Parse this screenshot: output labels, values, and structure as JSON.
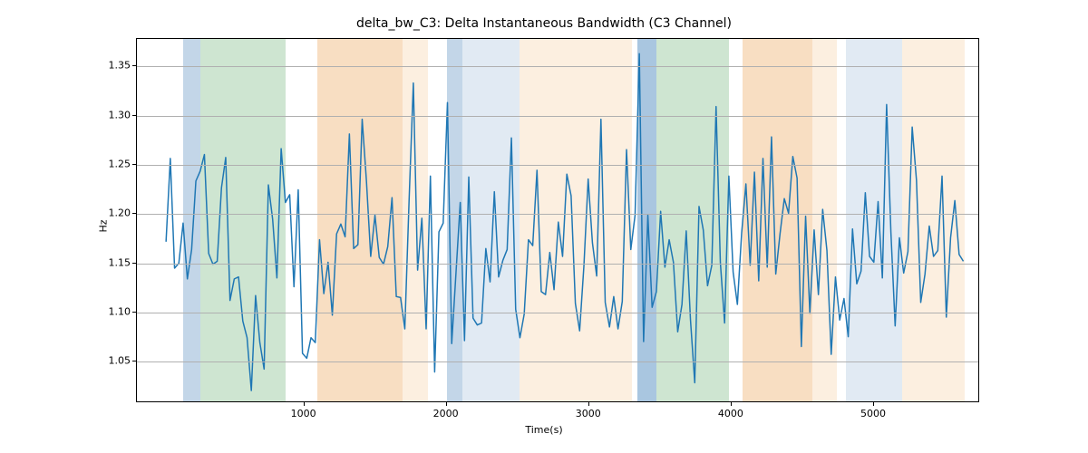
{
  "chart_data": {
    "type": "line",
    "title": "delta_bw_C3: Delta Instantaneous Bandwidth (C3 Channel)",
    "xlabel": "Time(s)",
    "ylabel": "Hz",
    "xlim": [
      -175,
      5745
    ],
    "ylim": [
      1.008,
      1.378
    ],
    "xticks": [
      1000,
      2000,
      3000,
      4000,
      5000
    ],
    "yticks": [
      1.05,
      1.1,
      1.15,
      1.2,
      1.25,
      1.3,
      1.35
    ],
    "grid_y": true,
    "bands": [
      {
        "start": 150,
        "end": 270,
        "color": "#c3d6e8"
      },
      {
        "start": 270,
        "end": 870,
        "color": "#cee5d1"
      },
      {
        "start": 1090,
        "end": 1690,
        "color": "#f8dec2"
      },
      {
        "start": 1690,
        "end": 1870,
        "color": "#fcefe0"
      },
      {
        "start": 2000,
        "end": 2110,
        "color": "#c3d6e8"
      },
      {
        "start": 2110,
        "end": 2510,
        "color": "#e1eaf3"
      },
      {
        "start": 2510,
        "end": 3300,
        "color": "#fcefe0"
      },
      {
        "start": 3340,
        "end": 3470,
        "color": "#a9c6e0"
      },
      {
        "start": 3470,
        "end": 3980,
        "color": "#cee5d1"
      },
      {
        "start": 4080,
        "end": 4570,
        "color": "#f8dec2"
      },
      {
        "start": 4570,
        "end": 4740,
        "color": "#fcefe0"
      },
      {
        "start": 4800,
        "end": 4910,
        "color": "#e1eaf3"
      },
      {
        "start": 4910,
        "end": 5200,
        "color": "#e1eaf3"
      },
      {
        "start": 5200,
        "end": 5640,
        "color": "#fcefe0"
      }
    ],
    "series": [
      {
        "name": "delta_bw_C3",
        "color": "#1f77b4",
        "x_start": 30,
        "x_step": 30,
        "values": [
          1.171,
          1.256,
          1.144,
          1.149,
          1.19,
          1.133,
          1.163,
          1.233,
          1.243,
          1.26,
          1.159,
          1.148,
          1.151,
          1.226,
          1.257,
          1.111,
          1.133,
          1.135,
          1.09,
          1.073,
          1.019,
          1.116,
          1.068,
          1.041,
          1.229,
          1.194,
          1.134,
          1.266,
          1.211,
          1.219,
          1.125,
          1.224,
          1.057,
          1.052,
          1.073,
          1.068,
          1.173,
          1.118,
          1.15,
          1.096,
          1.179,
          1.189,
          1.176,
          1.281,
          1.164,
          1.168,
          1.296,
          1.233,
          1.156,
          1.198,
          1.155,
          1.148,
          1.166,
          1.216,
          1.115,
          1.114,
          1.082,
          1.213,
          1.333,
          1.142,
          1.195,
          1.082,
          1.238,
          1.038,
          1.181,
          1.19,
          1.313,
          1.067,
          1.139,
          1.211,
          1.07,
          1.237,
          1.093,
          1.086,
          1.088,
          1.164,
          1.13,
          1.222,
          1.135,
          1.152,
          1.163,
          1.277,
          1.102,
          1.073,
          1.097,
          1.173,
          1.167,
          1.244,
          1.12,
          1.117,
          1.16,
          1.122,
          1.191,
          1.156,
          1.24,
          1.218,
          1.108,
          1.08,
          1.146,
          1.235,
          1.17,
          1.136,
          1.296,
          1.109,
          1.084,
          1.115,
          1.082,
          1.11,
          1.265,
          1.163,
          1.198,
          1.363,
          1.069,
          1.198,
          1.104,
          1.12,
          1.202,
          1.145,
          1.173,
          1.15,
          1.079,
          1.107,
          1.182,
          1.091,
          1.027,
          1.207,
          1.183,
          1.126,
          1.147,
          1.309,
          1.15,
          1.088,
          1.238,
          1.14,
          1.107,
          1.18,
          1.23,
          1.147,
          1.242,
          1.131,
          1.256,
          1.145,
          1.278,
          1.138,
          1.179,
          1.215,
          1.2,
          1.258,
          1.236,
          1.064,
          1.197,
          1.098,
          1.183,
          1.117,
          1.204,
          1.162,
          1.056,
          1.135,
          1.091,
          1.113,
          1.074,
          1.184,
          1.128,
          1.141,
          1.221,
          1.156,
          1.15,
          1.212,
          1.134,
          1.311,
          1.181,
          1.085,
          1.175,
          1.139,
          1.161,
          1.288,
          1.234,
          1.109,
          1.138,
          1.187,
          1.156,
          1.162,
          1.238,
          1.094,
          1.175,
          1.213,
          1.158,
          1.151
        ]
      }
    ]
  }
}
